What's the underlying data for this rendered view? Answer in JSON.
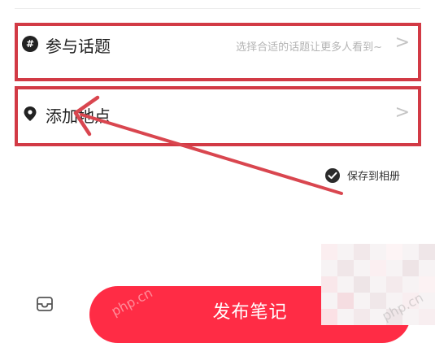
{
  "topic_row": {
    "icon": "hashtag-icon",
    "icon_glyph": "#",
    "label": "参与话题",
    "hint": "选择合适的话题让更多人看到~",
    "chevron": ">"
  },
  "location_row": {
    "icon": "location-pin-icon",
    "label": "添加地点",
    "chevron": ">"
  },
  "save_to_album": {
    "icon": "check-circle-icon",
    "label": "保存到相册",
    "checked": true
  },
  "bottom_bar": {
    "draft_icon": "draft-box-icon",
    "publish_label": "发布笔记"
  },
  "watermark": "php.cn",
  "colors": {
    "highlight_border": "#d23a45",
    "annotation_arrow": "#d9464f",
    "publish_button": "#ff2c45"
  }
}
